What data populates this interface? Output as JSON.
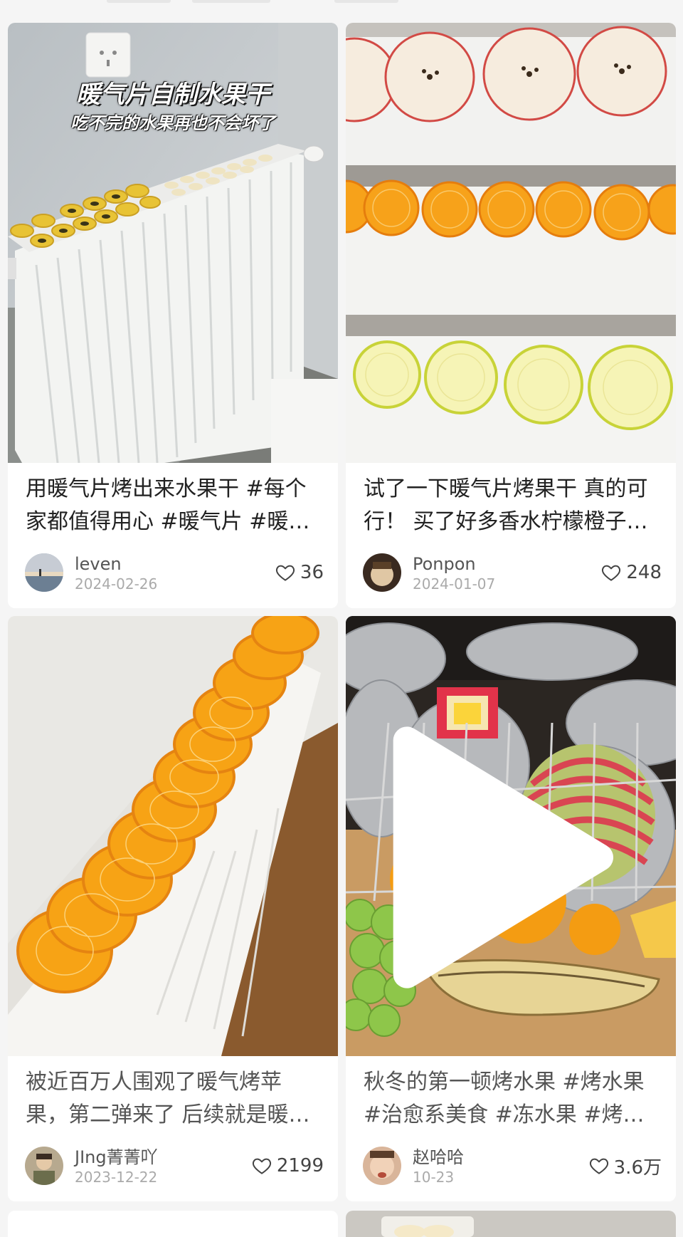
{
  "feed": {
    "cards": [
      {
        "overlay_title": "暖气片自制水果干",
        "overlay_subtitle": "吃不完的水果再也不会坏了",
        "title": "用暖气片烤出来水果干 #每个家都值得用心 #暖气片 #暖气片烤水果干",
        "author": "leven",
        "date": "2024-02-26",
        "likes": "36",
        "like_icon": "heart-outline-icon"
      },
      {
        "title": "试了一下暖气片烤果干 真的可行！ 买了好多香水柠檬橙子苹果",
        "author": "Ponpon",
        "date": "2024-01-07",
        "likes": "248",
        "like_icon": "heart-outline-icon"
      },
      {
        "title": "被近百万人围观了暖气烤苹果，第二弹来了 后续就是暖气片烤橙子",
        "author": "JIng菁菁吖",
        "date": "2023-12-22",
        "likes": "2199",
        "like_icon": "heart-outline-icon"
      },
      {
        "title": "秋冬的第一顿烤水果 #烤水果 #治愈系美食 #冻水果 #烤苹果",
        "author": "赵哈哈",
        "date": "10-23",
        "likes": "3.6万",
        "like_icon": "heart-outline-icon",
        "video_icon": "play-icon"
      }
    ]
  },
  "colors": {
    "background": "#f5f5f5",
    "card": "#ffffff",
    "title_text": "#222222",
    "meta_text": "#aaaaaa"
  }
}
